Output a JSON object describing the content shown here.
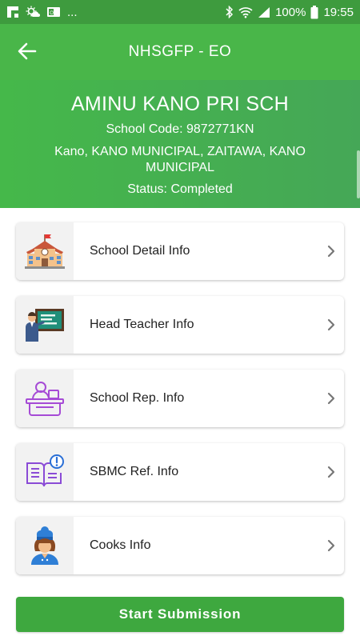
{
  "status_bar": {
    "battery": "100%",
    "time": "19:55",
    "more": "...",
    "left_icons": [
      "flipboard-icon",
      "weather-icon",
      "outlook-icon"
    ],
    "right_icons": [
      "bluetooth-icon",
      "wifi-icon",
      "signal-icon",
      "battery-icon"
    ]
  },
  "app_bar": {
    "title": "NHSGFP - EO",
    "back_icon": "arrow-back-icon"
  },
  "school": {
    "name": "AMINU KANO PRI SCH",
    "code": "School Code: 9872771KN",
    "address": "Kano, KANO MUNICIPAL, ZAITAWA, KANO MUNICIPAL",
    "status": "Status: Completed"
  },
  "menu": {
    "items": [
      {
        "label": "School Detail Info",
        "icon": "school-building-icon"
      },
      {
        "label": "Head Teacher Info",
        "icon": "teacher-board-icon"
      },
      {
        "label": "School Rep. Info",
        "icon": "desk-person-icon"
      },
      {
        "label": "SBMC Ref. Info",
        "icon": "book-alert-icon"
      },
      {
        "label": "Cooks Info",
        "icon": "cook-icon"
      }
    ]
  },
  "submit": {
    "label": "Start Submission"
  },
  "colors": {
    "status_bar": "#3e9b3e",
    "app_bar": "#49b649",
    "header": "#45b84a",
    "button": "#3ea83f"
  }
}
